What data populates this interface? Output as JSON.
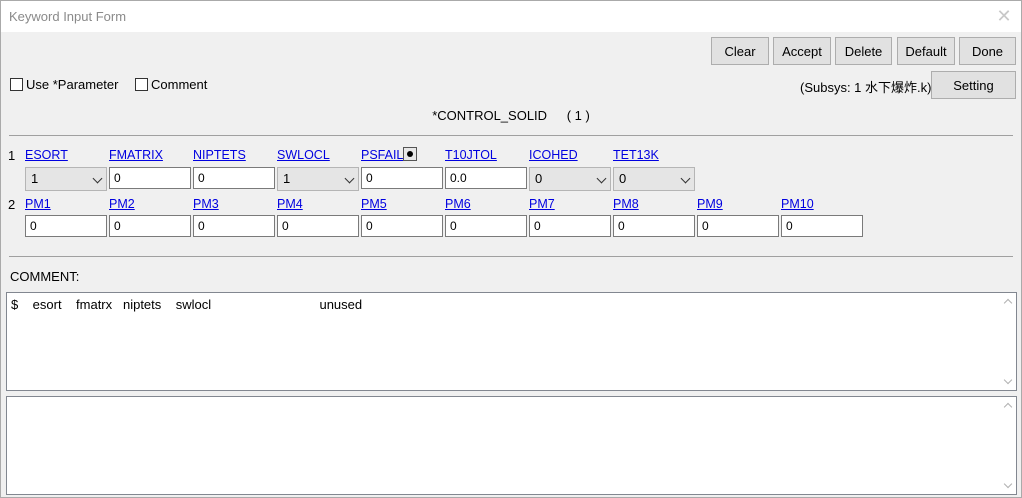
{
  "window": {
    "title": "Keyword Input Form",
    "close_glyph": "✕"
  },
  "toolbar": {
    "clear": "Clear",
    "accept": "Accept",
    "delete": "Delete",
    "default": "Default",
    "done": "Done",
    "setting": "Setting"
  },
  "options": {
    "use_parameter": "Use *Parameter",
    "comment": "Comment"
  },
  "subsys": "(Subsys: 1 水下爆炸.k)",
  "keyword": {
    "name": "*CONTROL_SOLID",
    "count": "( 1 )"
  },
  "row1": {
    "num": "1",
    "fields": [
      {
        "label": "ESORT",
        "value": "1",
        "kind": "select"
      },
      {
        "label": "FMATRIX",
        "value": "0",
        "kind": "text"
      },
      {
        "label": "NIPTETS",
        "value": "0",
        "kind": "text"
      },
      {
        "label": "SWLOCL",
        "value": "1",
        "kind": "select"
      },
      {
        "label": "PSFAIL",
        "value": "0",
        "kind": "text"
      },
      {
        "label": "T10JTOL",
        "value": "0.0",
        "kind": "text"
      },
      {
        "label": "ICOHED",
        "value": "0",
        "kind": "select"
      },
      {
        "label": "TET13K",
        "value": "0",
        "kind": "select"
      }
    ]
  },
  "row2": {
    "num": "2",
    "fields": [
      {
        "label": "PM1",
        "value": "0"
      },
      {
        "label": "PM2",
        "value": "0"
      },
      {
        "label": "PM3",
        "value": "0"
      },
      {
        "label": "PM4",
        "value": "0"
      },
      {
        "label": "PM5",
        "value": "0"
      },
      {
        "label": "PM6",
        "value": "0"
      },
      {
        "label": "PM7",
        "value": "0"
      },
      {
        "label": "PM8",
        "value": "0"
      },
      {
        "label": "PM9",
        "value": "0"
      },
      {
        "label": "PM10",
        "value": "0"
      }
    ]
  },
  "comment": {
    "label": "COMMENT:",
    "line": "$    esort    fmatrx   niptets    swlocl                              unused"
  }
}
